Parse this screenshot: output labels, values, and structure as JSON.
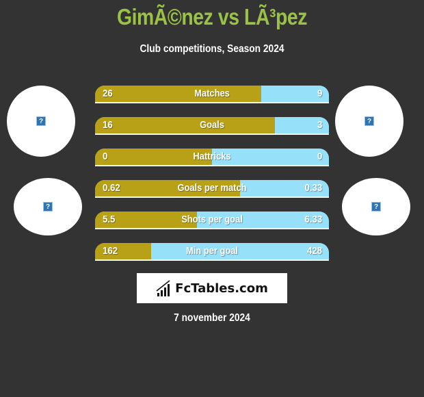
{
  "header": {
    "title": "GimÃ©nez vs LÃ³pez",
    "subtitle": "Club competitions, Season 2024"
  },
  "players": {
    "left": {
      "avatar_icon": "broken-image-icon",
      "club_icon": "broken-image-icon"
    },
    "right": {
      "avatar_icon": "broken-image-icon",
      "club_icon": "broken-image-icon"
    }
  },
  "colors": {
    "left_bar": "#b9a117",
    "right_bar": "#96e0fa",
    "title": "#9bc146",
    "background": "#333333"
  },
  "stats": [
    {
      "label": "Matches",
      "left": "26",
      "right": "9",
      "left_share": 0.71
    },
    {
      "label": "Goals",
      "left": "16",
      "right": "3",
      "left_share": 0.77
    },
    {
      "label": "Hattricks",
      "left": "0",
      "right": "0",
      "left_share": 0.5
    },
    {
      "label": "Goals per match",
      "left": "0.62",
      "right": "0.33",
      "left_share": 0.62
    },
    {
      "label": "Shots per goal",
      "left": "5.5",
      "right": "6.33",
      "left_share": 0.435
    },
    {
      "label": "Min per goal",
      "left": "162",
      "right": "428",
      "left_share": 0.24
    }
  ],
  "logo": {
    "text": "FcTables.com",
    "icon": "bar-chart-icon"
  },
  "footer": {
    "date": "7 november 2024"
  }
}
